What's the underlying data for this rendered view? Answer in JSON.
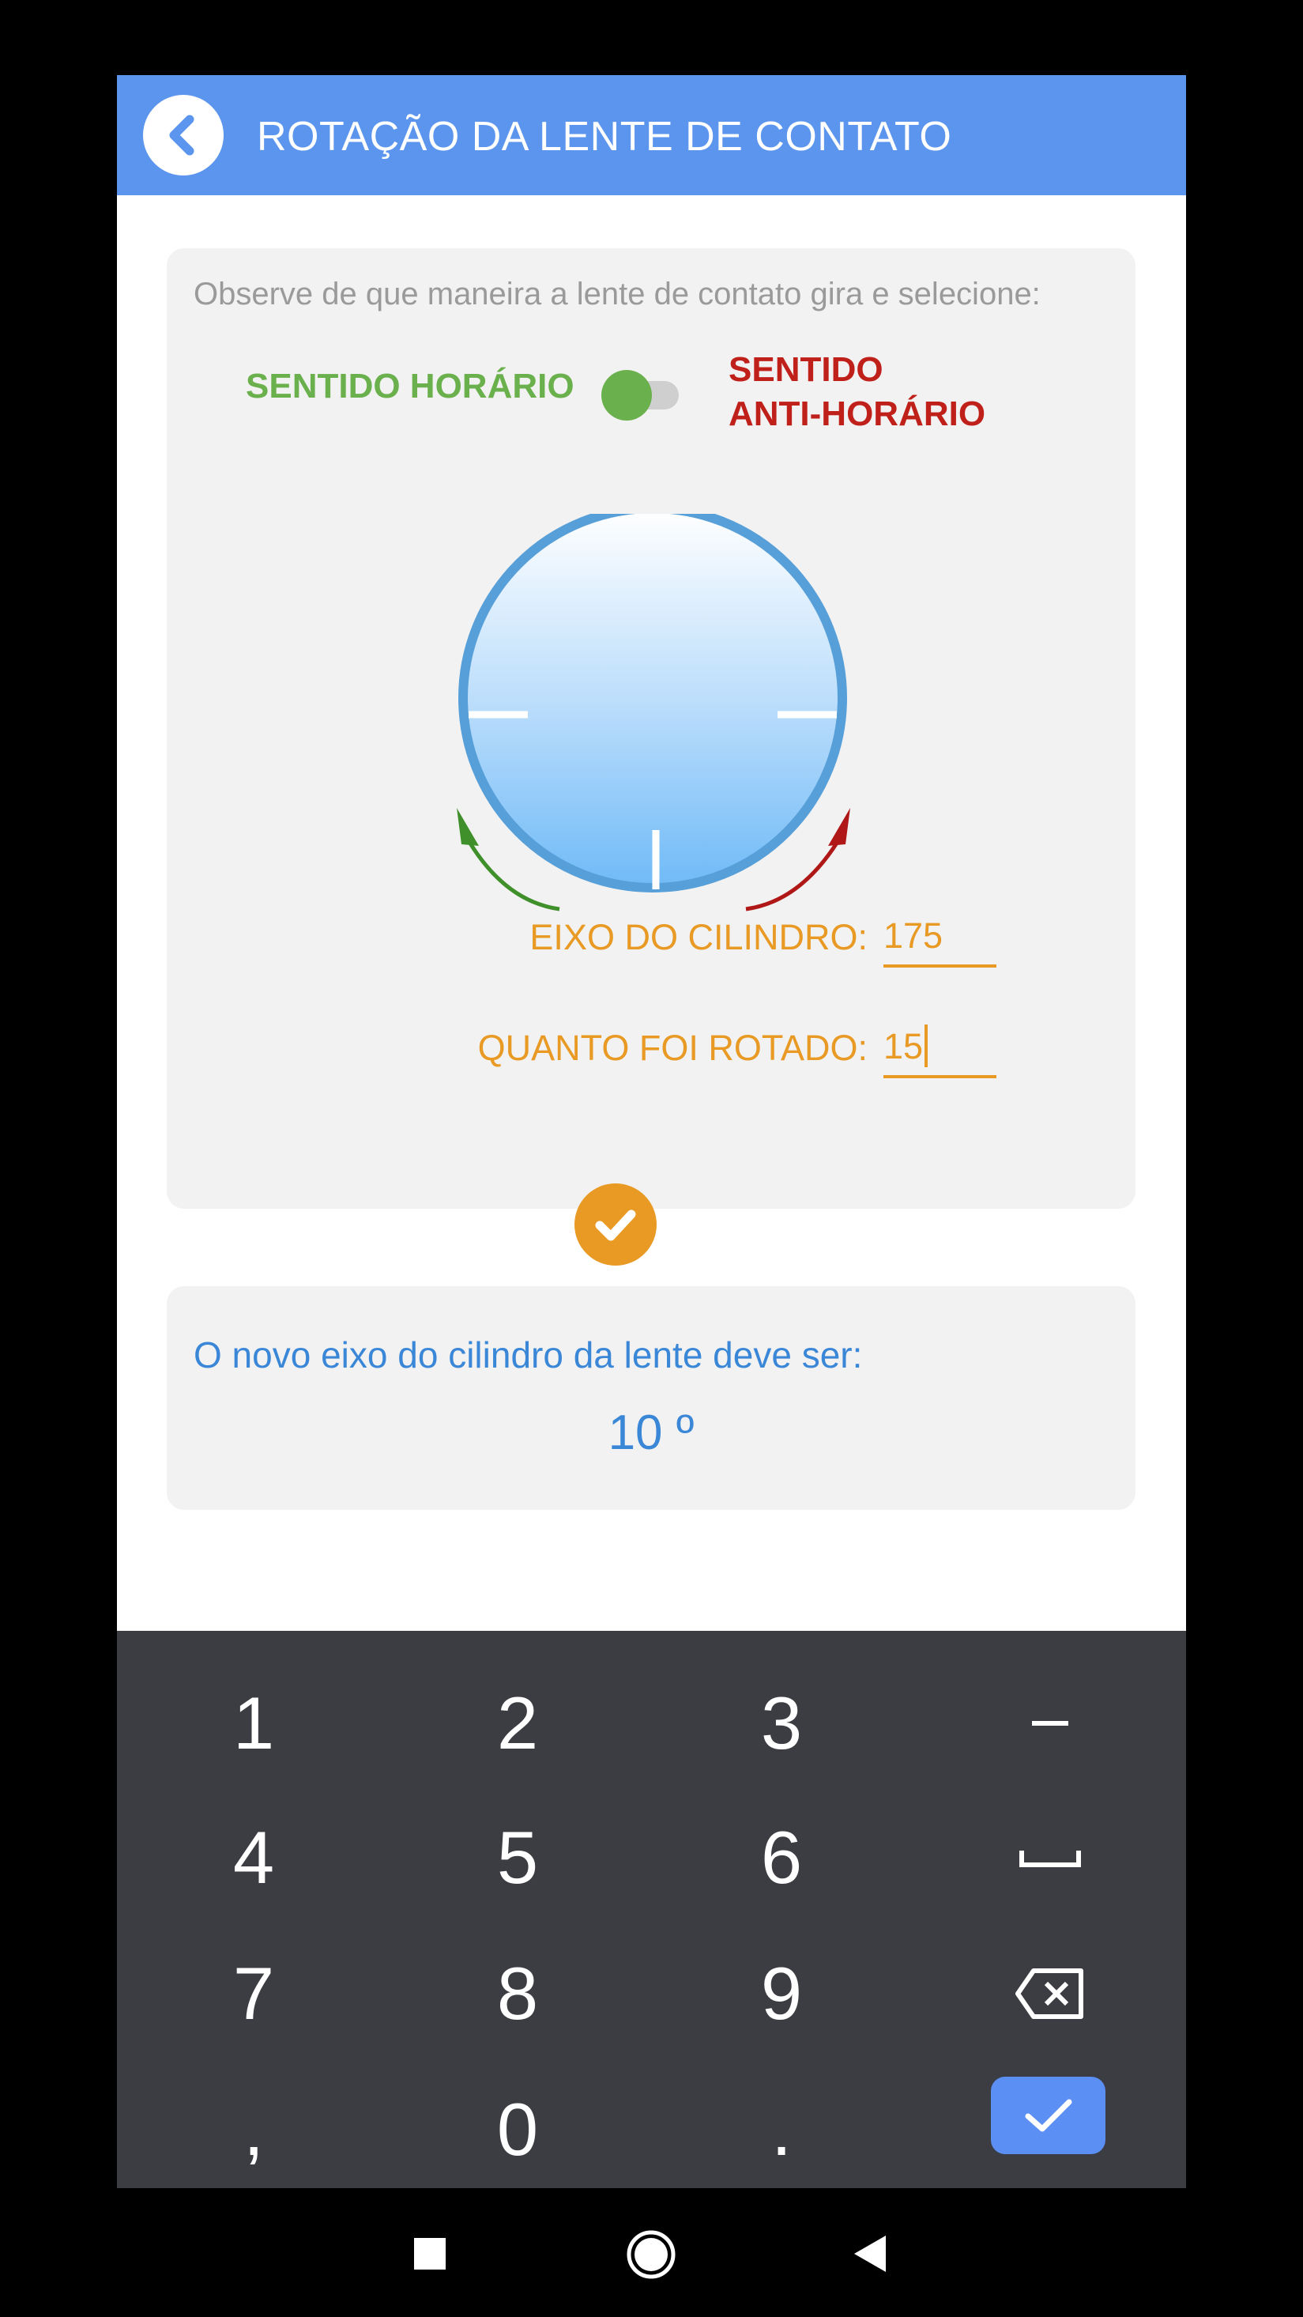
{
  "header": {
    "title": "ROTAÇÃO DA LENTE DE CONTATO",
    "back_icon": "chevron-left-icon"
  },
  "rotation_card": {
    "instruction": "Observe de que maneira a lente de contato gira e selecione:",
    "clockwise_label": "SENTIDO HORÁRIO",
    "counterclockwise_label_line1": "SENTIDO",
    "counterclockwise_label_line2": "ANTI-HORÁRIO",
    "toggle_state": "clockwise",
    "cylinder_axis_label": "EIXO DO CILINDRO:",
    "cylinder_axis_value": "175",
    "rotation_amount_label": "QUANTO FOI ROTADO:",
    "rotation_amount_value": "15",
    "confirm_icon": "check-icon"
  },
  "result_card": {
    "label": "O novo eixo do cilindro da lente deve ser:",
    "value": "10 º"
  },
  "keyboard": {
    "rows": [
      [
        "1",
        "2",
        "3",
        "-"
      ],
      [
        "4",
        "5",
        "6",
        "space-icon"
      ],
      [
        "7",
        "8",
        "9",
        "backspace-icon"
      ],
      [
        ",",
        "0",
        ".",
        "done-check-icon"
      ]
    ]
  },
  "navbar": {
    "items": [
      "recents-square-icon",
      "home-circle-icon",
      "back-triangle-icon"
    ]
  },
  "colors": {
    "appbar": "#5b95ee",
    "clockwise": "#6ab04c",
    "counterclockwise": "#c0201a",
    "accent_orange": "#e89a24",
    "result_blue": "#3a87d8",
    "keyboard_bg": "#3b3d42"
  }
}
